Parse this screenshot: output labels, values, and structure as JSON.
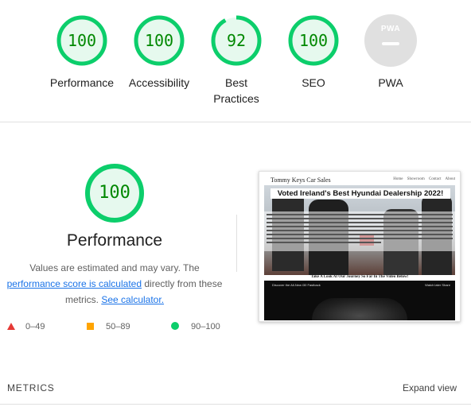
{
  "gauges": [
    {
      "label": "Performance",
      "score": "100",
      "value": 100
    },
    {
      "label": "Accessibility",
      "score": "100",
      "value": 100
    },
    {
      "label": "Best Practices",
      "score": "92",
      "value": 92
    },
    {
      "label": "SEO",
      "score": "100",
      "value": 100
    },
    {
      "label": "PWA",
      "badge": "PWA"
    }
  ],
  "colors": {
    "pass": "#0cce6b",
    "pass_text": "#008800",
    "pass_bg": "#e6f9ee",
    "average": "#ffa400",
    "fail": "#e53935",
    "link": "#1a73e8"
  },
  "performance": {
    "score": "100",
    "value": 100,
    "title": "Performance",
    "desc_1": "Values are estimated and may vary. The",
    "desc_link": "performance score is calculated",
    "desc_2": "directly from these metrics.",
    "calc_link": "See calculator."
  },
  "legend": [
    {
      "shape": "triangle",
      "range": "0–49"
    },
    {
      "shape": "square",
      "range": "50–89"
    },
    {
      "shape": "circle",
      "range": "90–100"
    }
  ],
  "screenshot": {
    "site_title": "Tommy Keys Car Sales",
    "nav": "Home Showroom Contact About",
    "banner": "Voted Ireland's Best Hyundai Dealership 2022!",
    "caption": "Take A Look At Our Journey So Far In The Video Below!",
    "video_title": "Discover the All-New i30 Fastback",
    "video_controls": "Watch later  Share"
  },
  "metrics": {
    "title": "METRICS",
    "expand": "Expand view"
  }
}
